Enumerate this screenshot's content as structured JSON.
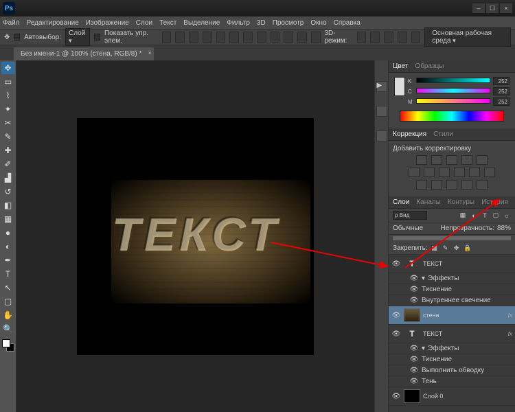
{
  "app": {
    "name": "Ps"
  },
  "menu": [
    "Файл",
    "Редактирование",
    "Изображение",
    "Слои",
    "Текст",
    "Выделение",
    "Фильтр",
    "3D",
    "Просмотр",
    "Окно",
    "Справка"
  ],
  "options": {
    "autoselect": "Автовыбор:",
    "autoselect_val": "Слой",
    "show_controls": "Показать упр. элем.",
    "mode3d": "3D-режим:",
    "workspace": "Основная рабочая среда"
  },
  "doc": {
    "title": "Без имени-1 @ 100% (стена, RGB/8) *"
  },
  "canvas_text": "ТЕКСТ",
  "panels": {
    "color": {
      "tab1": "Цвет",
      "tab2": "Образцы",
      "k": "K",
      "c": "C",
      "m": "M",
      "v": "252"
    },
    "corrections": {
      "tab1": "Коррекция",
      "tab2": "Стили",
      "title": "Добавить корректировку"
    },
    "layers": {
      "tabs": [
        "Слои",
        "Каналы",
        "Контуры",
        "История"
      ],
      "kind": "ρ Вид",
      "blend": "Обычные",
      "opacity_label": "Непрозрачность:",
      "opacity": "88%",
      "lock": "Закрепить:",
      "items": [
        {
          "name": "ТЕКСТ",
          "type": "text",
          "fx": true
        },
        {
          "name": "Эффекты",
          "type": "sub"
        },
        {
          "name": "Тиснение",
          "type": "sub"
        },
        {
          "name": "Внутреннее свечение",
          "type": "sub"
        },
        {
          "name": "стена",
          "type": "image",
          "sel": true,
          "fx": true
        },
        {
          "name": "ТЕКСТ",
          "type": "text",
          "fx": true
        },
        {
          "name": "Эффекты",
          "type": "sub"
        },
        {
          "name": "Тиснение",
          "type": "sub"
        },
        {
          "name": "Выполнить обводку",
          "type": "sub"
        },
        {
          "name": "Тень",
          "type": "sub"
        },
        {
          "name": "Слой 0",
          "type": "black"
        }
      ]
    }
  }
}
